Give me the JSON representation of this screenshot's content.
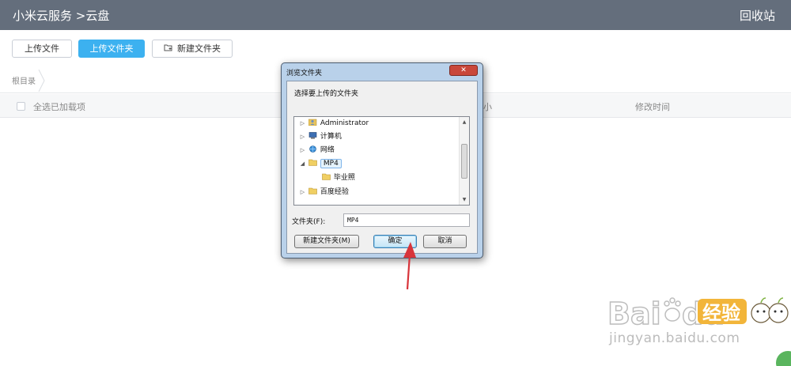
{
  "header": {
    "title": "小米云服务 >云盘",
    "recycle_bin": "回收站",
    "bar_color": "#646e7c"
  },
  "toolbar": {
    "upload_file": "上传文件",
    "upload_folder": "上传文件夹",
    "new_folder": "新建文件夹",
    "accent_color": "#3cb1f0"
  },
  "breadcrumb": {
    "root": "根目录"
  },
  "file_list": {
    "select_all": "全选已加载项",
    "col_size": "大小",
    "col_modified": "修改时间"
  },
  "dialog": {
    "title": "浏览文件夹",
    "close_icon": "✕",
    "prompt": "选择要上传的文件夹",
    "tree": [
      {
        "label": "Administrator",
        "icon": "user-folder-icon",
        "expander": "collapsed"
      },
      {
        "label": "计算机",
        "icon": "computer-icon",
        "expander": "collapsed"
      },
      {
        "label": "网络",
        "icon": "network-icon",
        "expander": "collapsed"
      },
      {
        "label": "MP4",
        "icon": "folder-icon",
        "expander": "expanded",
        "selected": true
      },
      {
        "label": "毕业照",
        "icon": "folder-icon",
        "expander": "none"
      },
      {
        "label": "百度经验",
        "icon": "folder-icon",
        "expander": "collapsed"
      }
    ],
    "folder_label": "文件夹(F):",
    "folder_value": "MP4",
    "new_folder_button": "新建文件夹(M)",
    "ok_button": "确定",
    "cancel_button": "取消"
  },
  "watermark": {
    "brand": "Bai",
    "brand_tail": "du",
    "jingyan": "经验",
    "url": "jingyan.baidu.com"
  }
}
